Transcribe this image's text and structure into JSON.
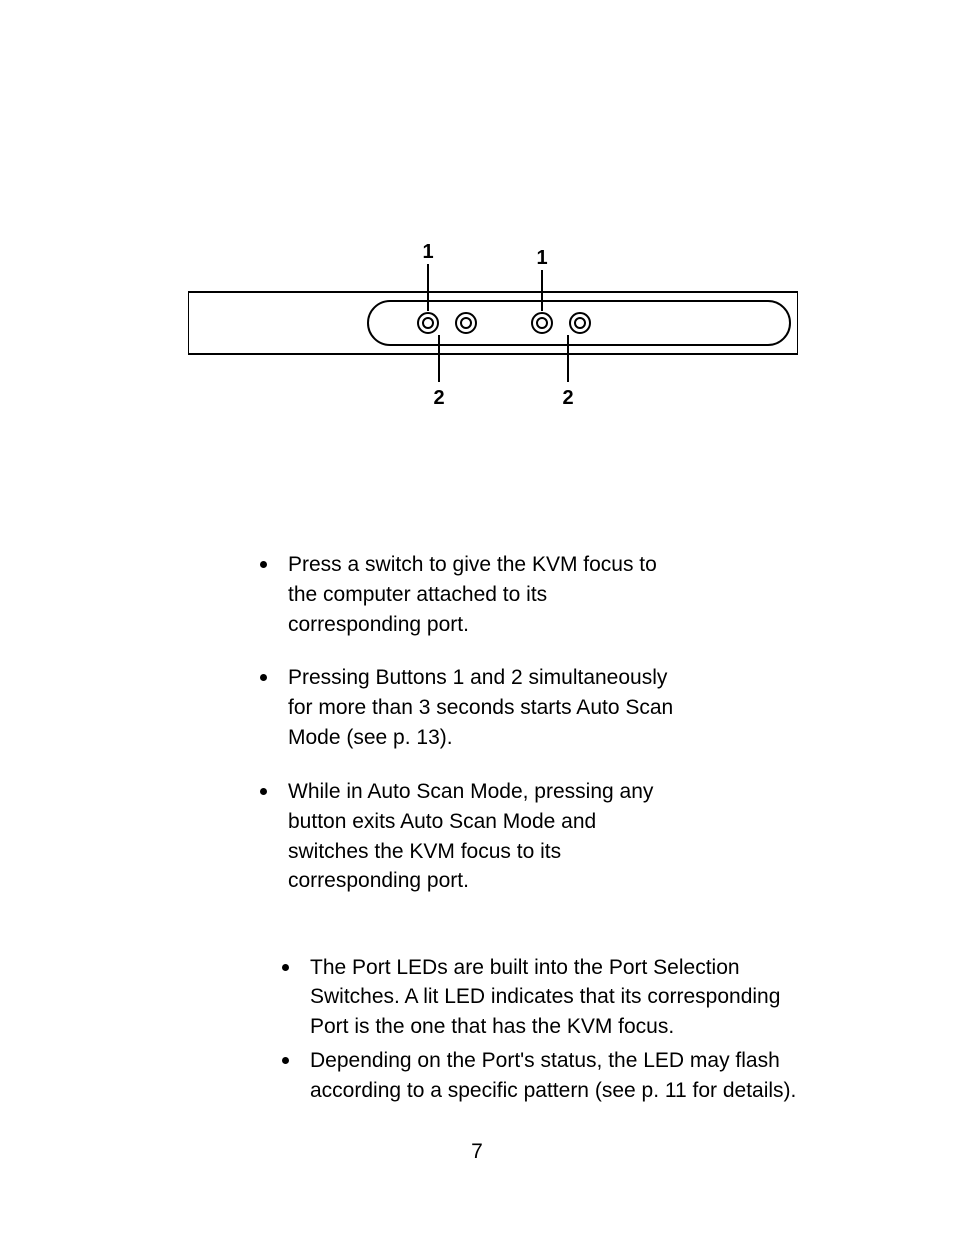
{
  "diagram": {
    "labels": {
      "top_left": "1",
      "top_right": "1",
      "bottom_left": "2",
      "bottom_right": "2"
    }
  },
  "section1": {
    "items": [
      "Press a switch to give the KVM focus to the computer attached to its corresponding port.",
      "Pressing Buttons 1 and 2 simultaneously for more than 3 seconds starts Auto Scan Mode (see p. 13).",
      "While in Auto Scan Mode, pressing any button exits Auto Scan Mode and switches the KVM focus to its corresponding port."
    ]
  },
  "section2": {
    "items": [
      "The Port LEDs are built into the Port Selection Switches. A lit LED indicates that its corresponding Port is the one that has the KVM focus.",
      "Depending on the Port's status, the LED may flash according to a specific pattern (see p. 11 for details)."
    ]
  },
  "page_number": "7"
}
